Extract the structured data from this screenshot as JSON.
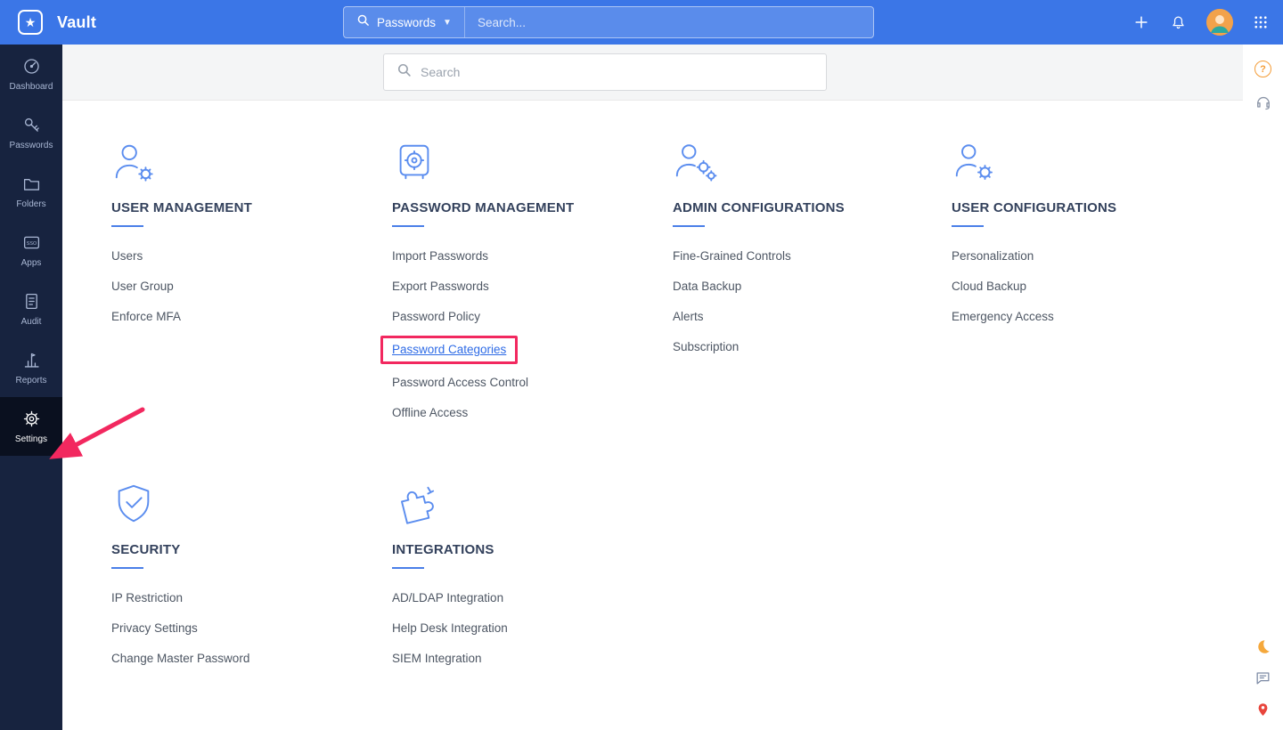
{
  "header": {
    "app_title": "Vault",
    "search_scope": "Passwords",
    "search_placeholder": "Search..."
  },
  "sidebar": {
    "sso_badge": "SSO",
    "items": [
      {
        "label": "Dashboard"
      },
      {
        "label": "Passwords"
      },
      {
        "label": "Folders"
      },
      {
        "label": "Apps"
      },
      {
        "label": "Audit"
      },
      {
        "label": "Reports"
      },
      {
        "label": "Settings"
      }
    ]
  },
  "main": {
    "search_placeholder": "Search",
    "highlighted_link": "Password Categories",
    "groups": [
      {
        "title": "USER MANAGEMENT",
        "items": [
          "Users",
          "User Group",
          "Enforce MFA"
        ]
      },
      {
        "title": "PASSWORD MANAGEMENT",
        "items": [
          "Import Passwords",
          "Export Passwords",
          "Password Policy",
          "Password Categories",
          "Password Access Control",
          "Offline Access"
        ]
      },
      {
        "title": "ADMIN CONFIGURATIONS",
        "items": [
          "Fine-Grained Controls",
          "Data Backup",
          "Alerts",
          "Subscription"
        ]
      },
      {
        "title": "USER CONFIGURATIONS",
        "items": [
          "Personalization",
          "Cloud Backup",
          "Emergency Access"
        ]
      },
      {
        "title": "SECURITY",
        "items": [
          "IP Restriction",
          "Privacy Settings",
          "Change Master Password"
        ]
      },
      {
        "title": "INTEGRATIONS",
        "items": [
          "AD/LDAP Integration",
          "Help Desk Integration",
          "SIEM Integration"
        ]
      }
    ]
  },
  "colors": {
    "header": "#3b76e7",
    "sidebar": "#17233f",
    "sidebar_active": "#0a101f",
    "accent": "#4a7fe8",
    "highlight_link": "#2e6be6",
    "annotation": "#f2285f"
  }
}
